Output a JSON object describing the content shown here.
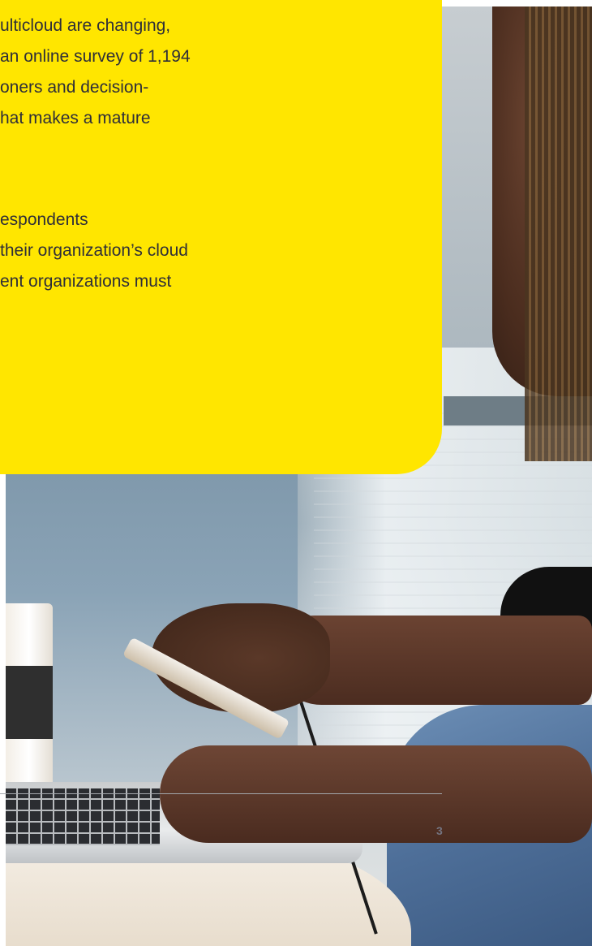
{
  "callout": {
    "paragraph_1": [
      "ulticloud are changing,",
      "an online survey of 1,194",
      "oners and decision-",
      "hat makes a mature"
    ],
    "paragraph_2": [
      "espondents",
      "their organization’s cloud",
      "ent organizations must"
    ],
    "background_color": "#ffe600"
  },
  "footer": {
    "page_number": "3"
  }
}
